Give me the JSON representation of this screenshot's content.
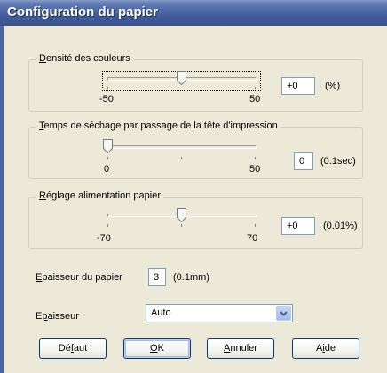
{
  "window": {
    "title": "Configuration du papier"
  },
  "density": {
    "label_first": "D",
    "label_rest": "ensité des couleurs",
    "value": "+0",
    "unit": "(%)",
    "min_label": "-50",
    "max_label": "50",
    "min": -50,
    "max": 50,
    "current": 0
  },
  "drying": {
    "label_first": "T",
    "label_rest": "emps de séchage par passage de la tête d'impression",
    "value": "0",
    "unit": "(0.1sec)",
    "min_label": "0",
    "max_label": "50",
    "min": 0,
    "max": 50,
    "current": 0
  },
  "feed": {
    "label_first": "R",
    "label_rest": "églage alimentation papier",
    "value": "+0",
    "unit": "(0.01%)",
    "min_label": "-70",
    "max_label": "70",
    "min": -70,
    "max": 70,
    "current": 0
  },
  "thickness": {
    "label_first": "E",
    "label_rest": "paisseur du papier",
    "value": "3",
    "unit": "(0.1mm)"
  },
  "platen": {
    "label_a": "E",
    "label_u": "p",
    "label_rest": "aisseur",
    "selected": "Auto"
  },
  "buttons": {
    "default_a": "Dé",
    "default_u": "f",
    "default_b": "aut",
    "ok_u": "O",
    "ok_rest": "K",
    "cancel_u": "A",
    "cancel_rest": "nnuler",
    "help_a": "A",
    "help_u": "i",
    "help_b": "de"
  }
}
